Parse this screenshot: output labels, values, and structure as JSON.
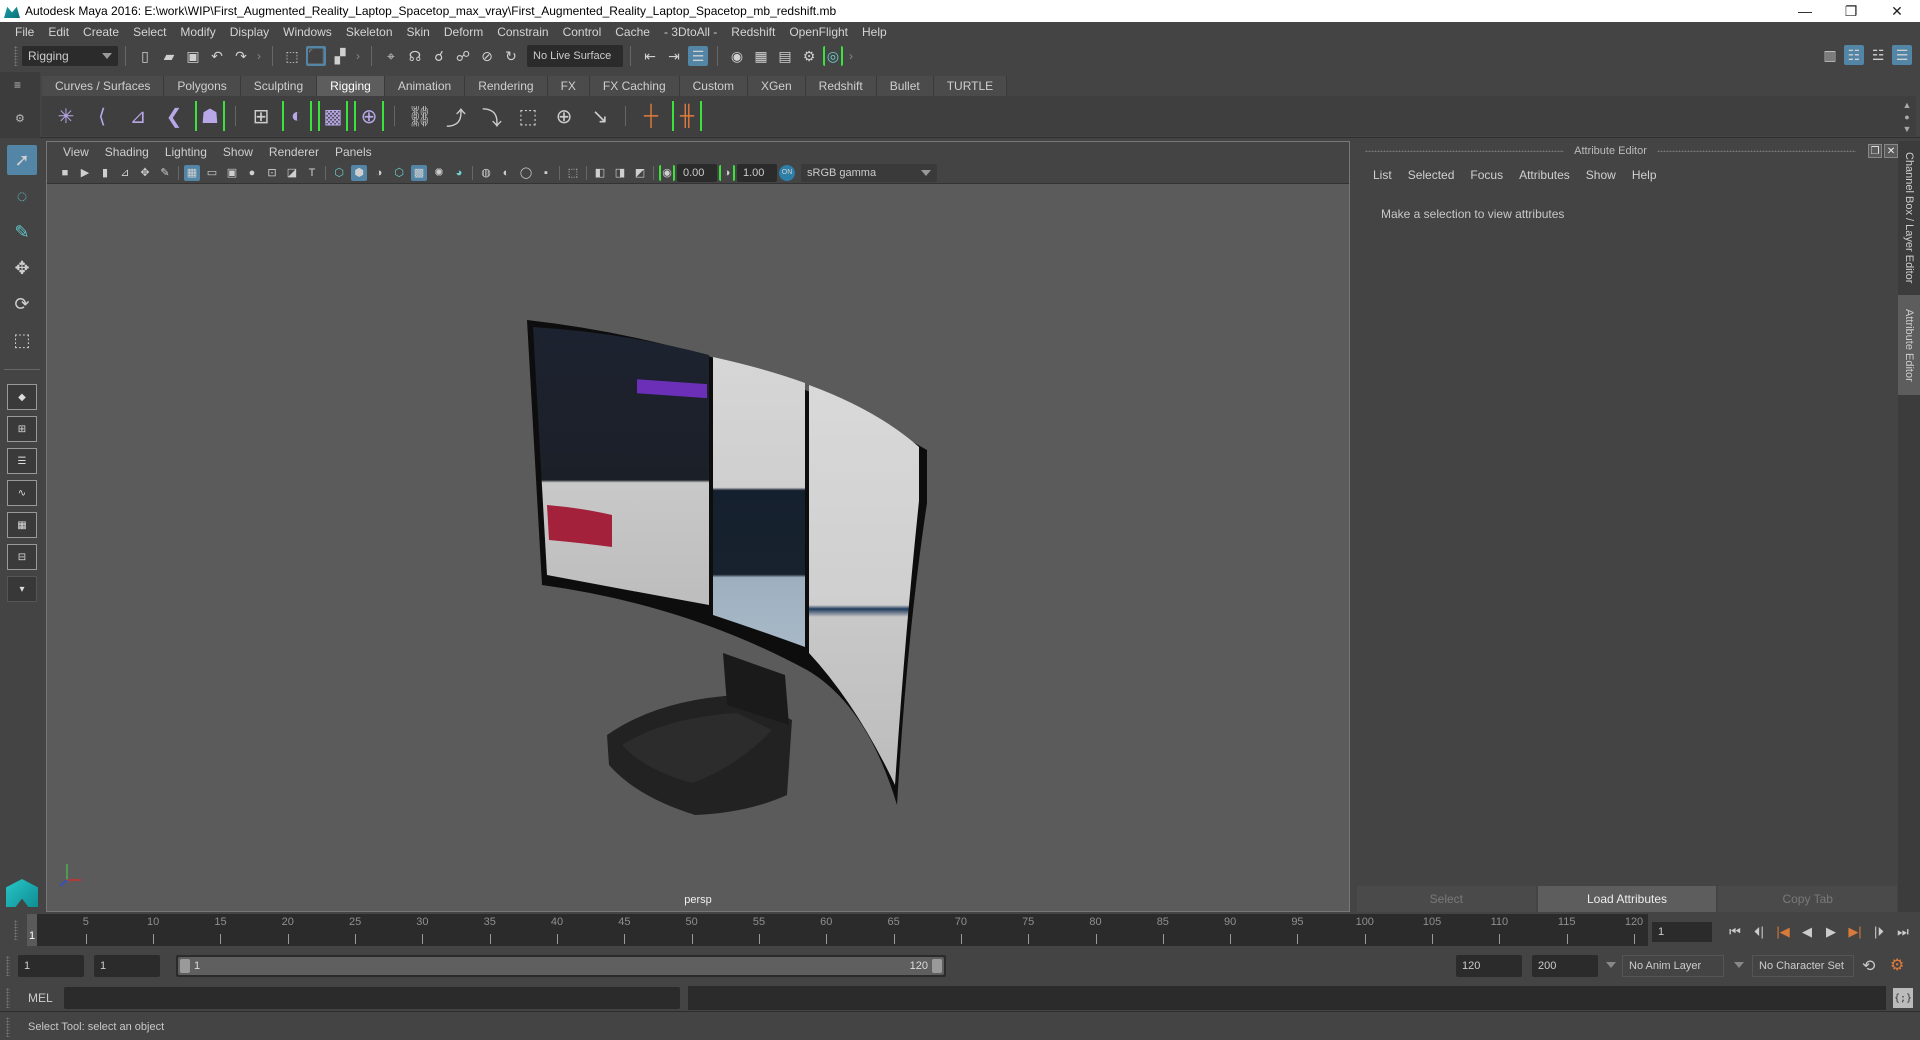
{
  "window": {
    "title": "Autodesk Maya 2016: E:\\work\\WIP\\First_Augmented_Reality_Laptop_Spacetop_max_vray\\First_Augmented_Reality_Laptop_Spacetop_mb_redshift.mb",
    "minimize": "—",
    "maximize": "❐",
    "close": "✕"
  },
  "menubar": [
    "File",
    "Edit",
    "Create",
    "Select",
    "Modify",
    "Display",
    "Windows",
    "Skeleton",
    "Skin",
    "Deform",
    "Constrain",
    "Control",
    "Cache",
    "- 3DtoAll -",
    "Redshift",
    "OpenFlight",
    "Help"
  ],
  "statusline": {
    "menuset": "Rigging",
    "live_surface": "No Live Surface"
  },
  "shelf": {
    "tabs": [
      "Curves / Surfaces",
      "Polygons",
      "Sculpting",
      "Rigging",
      "Animation",
      "Rendering",
      "FX",
      "FX Caching",
      "Custom",
      "XGen",
      "Redshift",
      "Bullet",
      "TURTLE"
    ],
    "active_tab": "Rigging"
  },
  "viewport": {
    "menu": [
      "View",
      "Shading",
      "Lighting",
      "Show",
      "Renderer",
      "Panels"
    ],
    "exposure": "0.00",
    "gamma": "1.00",
    "color_space": "sRGB gamma",
    "camera_label": "persp"
  },
  "attribute_editor": {
    "title": "Attribute Editor",
    "menu": [
      "List",
      "Selected",
      "Focus",
      "Attributes",
      "Show",
      "Help"
    ],
    "message": "Make a selection to view attributes",
    "buttons": {
      "select": "Select",
      "load": "Load Attributes",
      "copy": "Copy Tab"
    }
  },
  "side_tabs": {
    "channel_box": "Channel Box / Layer Editor",
    "attribute_editor": "Attribute Editor"
  },
  "timeline": {
    "start": 1,
    "end": 120,
    "current_frame": "1",
    "tick_labels": [
      "5",
      "10",
      "15",
      "20",
      "25",
      "30",
      "35",
      "40",
      "45",
      "50",
      "55",
      "60",
      "65",
      "70",
      "75",
      "80",
      "85",
      "90",
      "95",
      "100",
      "105",
      "110",
      "115",
      "120"
    ],
    "current_frame_field": "1"
  },
  "range": {
    "start_field": "1",
    "playback_start_field": "1",
    "range_start_label": "1",
    "range_end_label": "120",
    "playback_end_field": "120",
    "end_field": "200",
    "anim_layer": "No Anim Layer",
    "character_set": "No Character Set"
  },
  "command_line": {
    "language": "MEL"
  },
  "help_line": "Select Tool: select an object"
}
